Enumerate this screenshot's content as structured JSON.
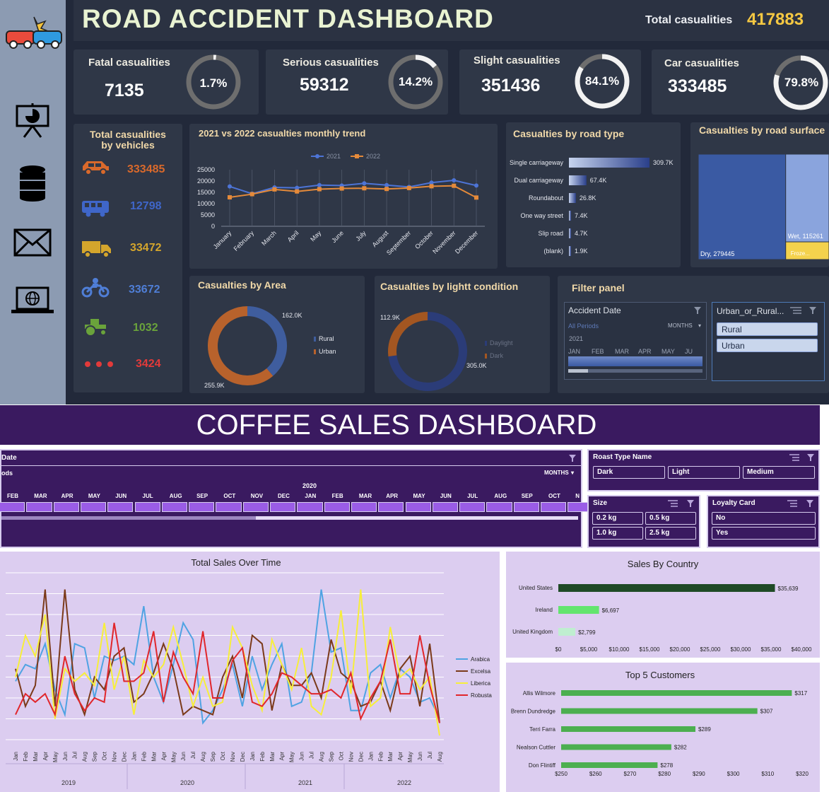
{
  "road": {
    "title": "ROAD ACCIDENT DASHBOARD",
    "total_label": "Total casualities",
    "total_value": "417883",
    "kpis": [
      {
        "label": "Fatal casualities",
        "value": "7135",
        "pct": "1.7%",
        "frac": 0.017
      },
      {
        "label": "Serious casualities",
        "value": "59312",
        "pct": "14.2%",
        "frac": 0.142
      },
      {
        "label": "Slight casualities",
        "value": "351436",
        "pct": "84.1%",
        "frac": 0.841
      },
      {
        "label": "Car casualities",
        "value": "333485",
        "pct": "79.8%",
        "frac": 0.798
      }
    ],
    "vehicles_title_1": "Total casualities",
    "vehicles_title_2": "by vehicles",
    "vehicles": [
      {
        "icon": "car-icon",
        "value": "333485",
        "color": "#d9692b"
      },
      {
        "icon": "bus-icon",
        "value": "12798",
        "color": "#3f66c9"
      },
      {
        "icon": "truck-icon",
        "value": "33472",
        "color": "#d4a52c"
      },
      {
        "icon": "motorcycle-icon",
        "value": "33672",
        "color": "#4f7ed6"
      },
      {
        "icon": "tractor-icon",
        "value": "1032",
        "color": "#6aa33b"
      },
      {
        "icon": "more-icon",
        "value": "3424",
        "color": "#e23a3a"
      }
    ],
    "trend_title": "2021 vs 2022 casualties monthly trend",
    "road_type_title": "Casualties by road type",
    "road_surface_title": "Casualties by road surface",
    "area_title": "Casualties by Area",
    "light_title": "Casualties by lightt condition",
    "filter_title": "Filter panel",
    "filter": {
      "date_header": "Accident Date",
      "all_periods": "All Periods",
      "months": "MONTHS",
      "year": "2021",
      "month_labels": [
        "JAN",
        "FEB",
        "MAR",
        "APR",
        "MAY",
        "JU"
      ],
      "urban_header": "Urban_or_Rural...",
      "urban_options": [
        "Rural",
        "Urban"
      ]
    }
  },
  "coffee": {
    "title": "COFFEE SALES DASHBOARD",
    "date_header": "Date",
    "periods_label": "ods",
    "months": "MONTHS",
    "year_label": "2020",
    "timeline_months": [
      "FEB",
      "MAR",
      "APR",
      "MAY",
      "JUN",
      "JUL",
      "AUG",
      "SEP",
      "OCT",
      "NOV",
      "DEC",
      "JAN",
      "FEB",
      "MAR",
      "APR",
      "MAY",
      "JUN",
      "JUL",
      "AUG",
      "SEP",
      "OCT",
      "N"
    ],
    "roast_header": "Roast Type Name",
    "roast_options": [
      "Dark",
      "Light",
      "Medium"
    ],
    "size_header": "Size",
    "size_options": [
      "0.2 kg",
      "0.5 kg",
      "1.0 kg",
      "2.5 kg"
    ],
    "loyalty_header": "Loyalty Card",
    "loyalty_options": [
      "No",
      "Yes"
    ],
    "sales_title": "Total Sales Over Time",
    "country_title": "Sales By Country",
    "customers_title": "Top 5 Customers"
  },
  "chart_data": [
    {
      "type": "line",
      "title": "2021 vs 2022 casualties monthly trend",
      "categories": [
        "January",
        "February",
        "March",
        "April",
        "May",
        "June",
        "July",
        "August",
        "September",
        "October",
        "November",
        "December"
      ],
      "series": [
        {
          "name": "2021",
          "color": "#4d74d6",
          "values": [
            17600,
            14400,
            17200,
            17000,
            18200,
            18000,
            19000,
            18200,
            17400,
            19300,
            20300,
            18000
          ]
        },
        {
          "name": "2022",
          "color": "#e58a3a",
          "values": [
            12800,
            14200,
            16300,
            15400,
            16400,
            16700,
            16800,
            16500,
            16900,
            17700,
            17900,
            12700
          ]
        }
      ],
      "yticks": [
        "25000",
        "20000",
        "15000",
        "10000",
        "5000",
        "0"
      ],
      "ylim": [
        0,
        25000
      ]
    },
    {
      "type": "bar",
      "title": "Casualties by road type",
      "categories": [
        "Single carriageway",
        "Dual carriageway",
        "Roundabout",
        "One way street",
        "Slip road",
        "(blank)"
      ],
      "values": [
        309.7,
        67.4,
        26.8,
        7.4,
        4.7,
        1.9
      ],
      "labels": [
        "309.7K",
        "67.4K",
        "26.8K",
        "7.4K",
        "4.7K",
        "1.9K"
      ]
    },
    {
      "type": "treemap",
      "title": "Casualties by road surface",
      "labels": [
        "Dry, 279445",
        "Wet, 115261",
        "Froze..."
      ],
      "values": [
        279445,
        115261,
        23177
      ],
      "colors": [
        "#3a5aa3",
        "#8aa4dd",
        "#f4d24d"
      ]
    },
    {
      "type": "pie",
      "title": "Casualties by Area",
      "labels": [
        "Rural",
        "Urban"
      ],
      "values": [
        162.0,
        255.9
      ],
      "value_labels": [
        "162.0K",
        "255.9K"
      ],
      "colors": [
        "#3f5d9e",
        "#b8622c"
      ]
    },
    {
      "type": "pie",
      "title": "Casualties by lightt condition",
      "labels": [
        "Daylight",
        "Dark"
      ],
      "values": [
        305.0,
        112.9
      ],
      "value_labels": [
        "305.0K",
        "112.9K"
      ],
      "colors": [
        "#2b3c78",
        "#a35621"
      ]
    },
    {
      "type": "line",
      "title": "Total Sales Over Time",
      "x": [
        "Jan",
        "Feb",
        "Mar",
        "Apr",
        "May",
        "Jun",
        "Jul",
        "Aug",
        "Sep",
        "Oct",
        "Nov",
        "Dec",
        "Jan",
        "Feb",
        "Mar",
        "Apr",
        "May",
        "Jun",
        "Jul",
        "Aug",
        "Sep",
        "Oct",
        "Nov",
        "Dec",
        "Jan",
        "Feb",
        "Mar",
        "Apr",
        "May",
        "Jun",
        "Jul",
        "Aug",
        "Sep",
        "Oct",
        "Nov",
        "Dec",
        "Jan",
        "Feb",
        "Mar",
        "Apr",
        "May",
        "Jun",
        "Jul",
        "Aug"
      ],
      "year_labels": [
        "2019",
        "2020",
        "2021",
        "2022"
      ],
      "series": [
        {
          "name": "Arabica",
          "color": "#4fa3e3",
          "values": [
            140,
            180,
            170,
            230,
            120,
            60,
            230,
            220,
            100,
            200,
            190,
            200,
            180,
            320,
            150,
            90,
            180,
            280,
            240,
            40,
            70,
            120,
            180,
            80,
            200,
            120,
            180,
            230,
            80,
            90,
            160,
            360,
            210,
            220,
            70,
            70,
            160,
            180,
            100,
            170,
            150,
            90,
            100,
            50
          ]
        },
        {
          "name": "Excelsa",
          "color": "#7b3a1a",
          "values": [
            170,
            80,
            130,
            360,
            80,
            360,
            120,
            60,
            150,
            120,
            200,
            220,
            90,
            110,
            160,
            230,
            170,
            60,
            80,
            70,
            60,
            150,
            200,
            100,
            250,
            230,
            70,
            180,
            130,
            130,
            160,
            100,
            240,
            160,
            140,
            80,
            90,
            140,
            70,
            170,
            200,
            80,
            230,
            40
          ]
        },
        {
          "name": "Liberica",
          "color": "#f7ef3a",
          "values": [
            150,
            250,
            200,
            300,
            50,
            170,
            140,
            160,
            130,
            280,
            120,
            200,
            60,
            190,
            150,
            180,
            270,
            180,
            80,
            150,
            80,
            90,
            270,
            220,
            130,
            70,
            240,
            180,
            120,
            220,
            80,
            60,
            150,
            310,
            110,
            360,
            80,
            100,
            270,
            150,
            170,
            120,
            150,
            10
          ]
        },
        {
          "name": "Robusta",
          "color": "#e1262b",
          "values": [
            60,
            110,
            90,
            110,
            60,
            200,
            110,
            70,
            100,
            90,
            280,
            140,
            140,
            160,
            260,
            90,
            210,
            150,
            110,
            260,
            100,
            100,
            190,
            220,
            90,
            80,
            110,
            160,
            150,
            130,
            110,
            110,
            120,
            100,
            160,
            50,
            100,
            140,
            240,
            110,
            110,
            250,
            130,
            40
          ]
        }
      ]
    },
    {
      "type": "bar",
      "title": "Sales By Country",
      "categories": [
        "United States",
        "Ireland",
        "United Kingdom"
      ],
      "values": [
        35639,
        6697,
        2799
      ],
      "labels": [
        "$35,639",
        "$6,697",
        "$2,799"
      ],
      "colors": [
        "#1f4a26",
        "#63e56e",
        "#bfeed0"
      ],
      "xticks": [
        "$0",
        "$5,000",
        "$10,000",
        "$15,000",
        "$20,000",
        "$25,000",
        "$30,000",
        "$35,000",
        "$40,000"
      ],
      "xlim": [
        0,
        40000
      ]
    },
    {
      "type": "bar",
      "title": "Top 5 Customers",
      "categories": [
        "Allis Wilmore",
        "Brenn Dundredge",
        "Terri Farra",
        "Nealson Cuttler",
        "Don Flintiff"
      ],
      "values": [
        317,
        307,
        289,
        282,
        278
      ],
      "labels": [
        "$317",
        "$307",
        "$289",
        "$282",
        "$278"
      ],
      "color": "#4caf50",
      "xticks": [
        "$250",
        "$260",
        "$270",
        "$280",
        "$290",
        "$300",
        "$310",
        "$320"
      ],
      "xlim": [
        250,
        320
      ]
    }
  ]
}
